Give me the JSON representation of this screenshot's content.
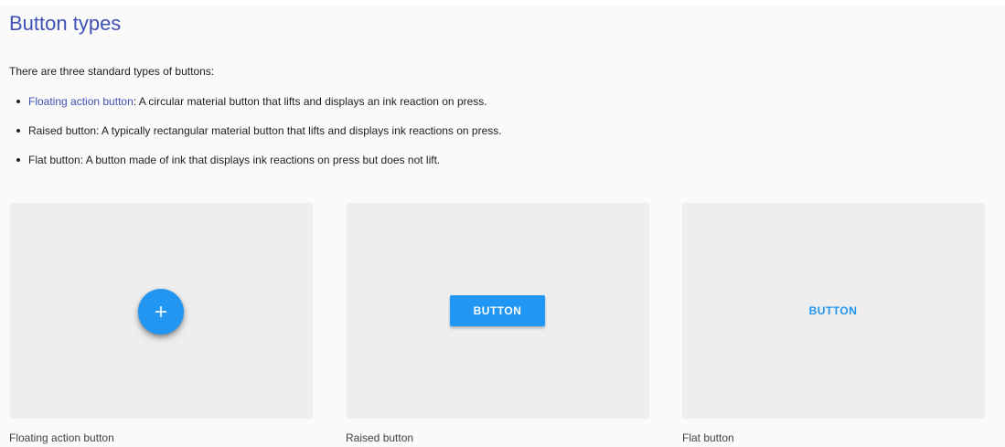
{
  "page": {
    "title": "Button types",
    "intro": "There are three standard types of buttons:"
  },
  "types": [
    {
      "link": "Floating action button",
      "description": ": A circular material button that lifts and displays an ink reaction on press."
    },
    {
      "description": "Raised button: A typically rectangular material button that lifts and displays ink reactions on press."
    },
    {
      "description": "Flat button: A button made of ink that displays ink reactions on press but does not lift."
    }
  ],
  "demos": {
    "fab_icon": "plus-icon",
    "raised_label": "BUTTON",
    "flat_label": "BUTTON"
  },
  "captions": [
    "Floating action button",
    "Raised button",
    "Flat button"
  ],
  "colors": {
    "title": "#3f51b5",
    "link": "#3f51b5",
    "primary": "#2196f3",
    "card_bg": "#eeeeee",
    "page_bg": "#fafafa"
  }
}
